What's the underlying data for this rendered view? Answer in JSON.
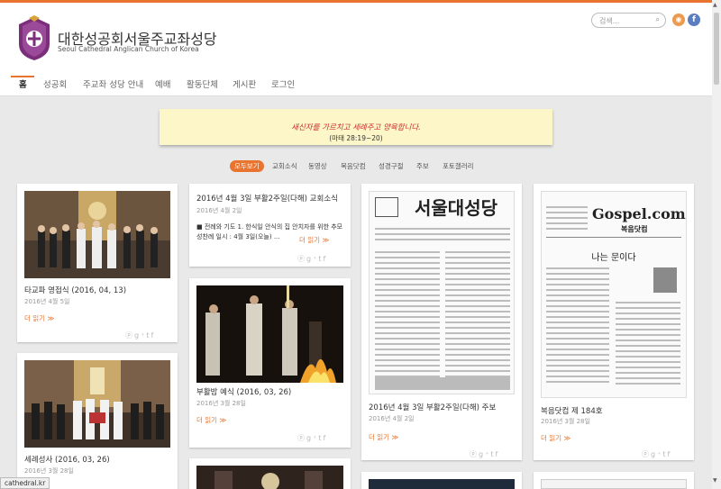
{
  "site": {
    "title": "대한성공회서울주교좌성당",
    "subtitle": "Seoul Cathedral Anglican Church of Korea",
    "search_placeholder": "검색...",
    "rss_icon": "rss-icon",
    "facebook_icon": "facebook-icon"
  },
  "nav": {
    "items": [
      "홈",
      "성공회",
      "주교좌 성당 안내",
      "예배",
      "활동단체",
      "게시판",
      "로그인"
    ],
    "active": "홈"
  },
  "banner": {
    "line1": "새신자를 가르치고 세례주고 양육합니다.",
    "line2": "(마태 28:19~20)"
  },
  "filters": [
    "모두보기",
    "교회소식",
    "동영상",
    "복음닷컴",
    "성경구절",
    "주보",
    "포토갤러리"
  ],
  "cards": {
    "c1": {
      "title": "타교파 영접식 (2016, 04, 13)",
      "date": "2016년 4월 5일",
      "more": "더 읽기 ≫"
    },
    "c2": {
      "title": "세례성사 (2016, 03, 26)",
      "date": "2016년 3월 28일"
    },
    "c3": {
      "title": "2016년 4월 3일 부활2주일(다해) 교회소식",
      "date": "2016년 4월 2일",
      "body": "■ 전례와 기도 1. 한식일 안식의 집 안치자를 위한 추모성찬례 일시 : 4월 3일(오늘) ...",
      "more": "더 읽기 ≫"
    },
    "c4": {
      "title": "부활밤 예식 (2016, 03, 26)",
      "date": "2016년 3월 28일",
      "more": "더 읽기 ≫"
    },
    "c5": {
      "title": "2016년 4월 3일 부활2주일(다해) 주보",
      "date": "2016년 4월 2일",
      "more": "더 읽기 ≫",
      "masthead": "서울대성당"
    },
    "c6": {
      "title": "복음닷컴 제 184호",
      "date": "2016년 3월 28일",
      "more": "더 읽기 ≫",
      "masthead": "Gospel.com",
      "masthead_sub": "복음닷컴",
      "heading": "나는 문이다"
    }
  },
  "status_url": "cathedral.kr"
}
